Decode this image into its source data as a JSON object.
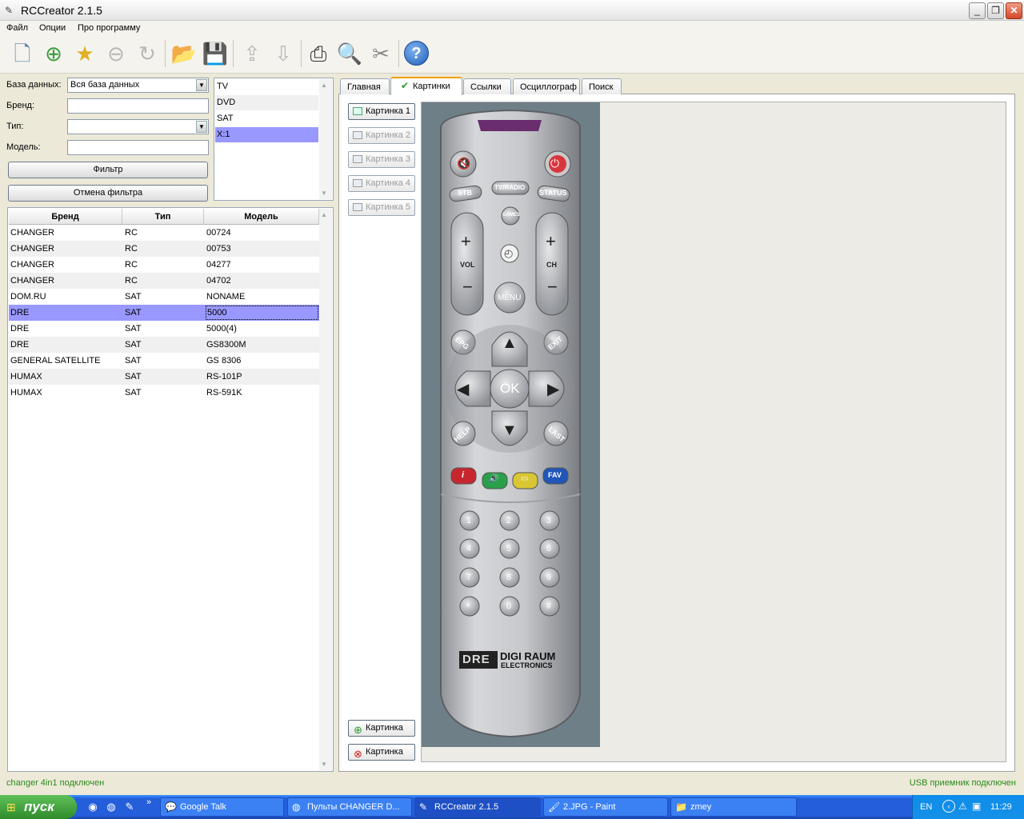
{
  "window": {
    "title": "RCCreator 2.1.5",
    "minimize": "_",
    "maximize": "❐",
    "close": "✕"
  },
  "menu": [
    "Файл",
    "Опции",
    "Про программу"
  ],
  "toolbar": [
    "new-icon",
    "add-icon",
    "favorite-icon",
    "remove-icon",
    "reload-icon",
    "open-icon",
    "save-icon",
    "upload-icon",
    "download-icon",
    "print-icon",
    "search-icon",
    "tools-icon",
    "help-icon"
  ],
  "filter": {
    "db_label": "База данных:",
    "db_value": "Вся база данных",
    "brand_label": "Бренд:",
    "brand_value": "",
    "type_label": "Тип:",
    "type_value": "",
    "model_label": "Модель:",
    "model_value": "",
    "filter_btn": "Фильтр",
    "reset_btn": "Отмена фильтра"
  },
  "types": [
    "TV",
    "DVD",
    "SAT",
    "X:1"
  ],
  "table": {
    "headers": [
      "Бренд",
      "Тип",
      "Модель"
    ],
    "rows": [
      [
        "CHANGER",
        "RC",
        "00724"
      ],
      [
        "CHANGER",
        "RC",
        "00753"
      ],
      [
        "CHANGER",
        "RC",
        "04277"
      ],
      [
        "CHANGER",
        "RC",
        "04702"
      ],
      [
        "DOM.RU",
        "SAT",
        "NONAME"
      ],
      [
        "DRE",
        "SAT",
        "5000"
      ],
      [
        "DRE",
        "SAT",
        "5000(4)"
      ],
      [
        "DRE",
        "SAT",
        "GS8300M"
      ],
      [
        "GENERAL SATELLITE",
        "SAT",
        "GS 8306"
      ],
      [
        "HUMAX",
        "SAT",
        "RS-101P"
      ],
      [
        "HUMAX",
        "SAT",
        "RS-591K"
      ]
    ]
  },
  "tabs": [
    "Главная",
    "Картинки",
    "Ссылки",
    "Осциллограф",
    "Поиск"
  ],
  "pictures": [
    "Картинка 1",
    "Картинка 2",
    "Картинка 3",
    "Картинка 4",
    "Картинка 5"
  ],
  "add_picture": "Картинка",
  "del_picture": "Картинка",
  "remote": {
    "buttons": [
      "STB",
      "TV/RADIO",
      "STATUS",
      "GAMES",
      "VOL",
      "CH",
      "MENU",
      "EPG",
      "EXIT",
      "OK",
      "HELP",
      "LAST",
      "FAV"
    ],
    "digits": [
      "1",
      "2",
      "3",
      "4",
      "5",
      "6",
      "7",
      "8",
      "9",
      "*",
      "0",
      "#"
    ],
    "brand_logo": "DRE",
    "brand_name": "DIGI RAUM",
    "brand_sub": "ELECTRONICS"
  },
  "status": {
    "left": "changer 4in1 подключен",
    "right": "USB приемник подключен"
  },
  "taskbar": {
    "start": "пуск",
    "tasks": [
      "Google Talk",
      "Пульты CHANGER D...",
      "RCCreator 2.1.5",
      "2.JPG - Paint",
      "zmey"
    ],
    "lang": "EN",
    "clock": "11:29"
  }
}
